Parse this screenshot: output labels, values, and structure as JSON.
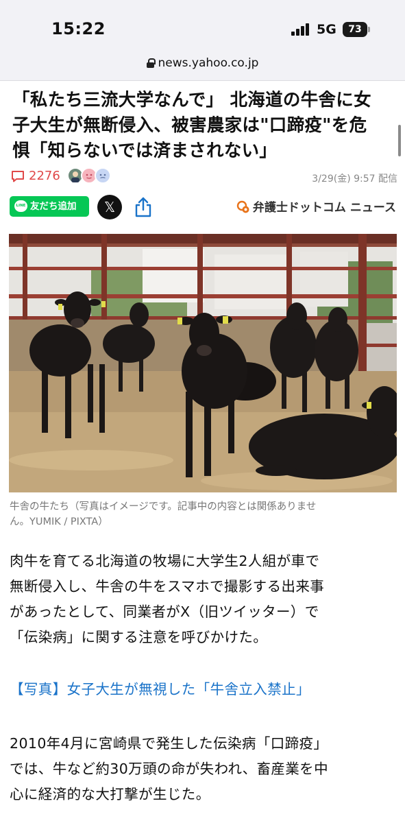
{
  "status_bar": {
    "time": "15:22",
    "network": "5G",
    "battery": "73"
  },
  "browser": {
    "url": "news.yahoo.co.jp"
  },
  "article": {
    "title_lines": [
      "「私たち三流大学なんで」 北海道の牛舎に女",
      "子大生が無断侵入、被害農家は\"口蹄疫\"を危",
      "惧「知らないでは済まされない」"
    ],
    "comment_count": "2276",
    "date": "3/29(金) 9:57 配信",
    "share": {
      "line_label": "友だち追加",
      "line_icon_text": "LINE",
      "x_label": "𝕏"
    },
    "source_brand": "弁護士ドットコム ニュース",
    "photo_caption_lines": [
      "牛舎の牛たち（写真はイメージです。記事中の内容とは関係ありませ",
      "ん。YUMIK / PIXTA）"
    ],
    "paragraph1_lines": [
      "肉牛を育てる北海道の牧場に大学生2人組が車で",
      "無断侵入し、牛舎の牛をスマホで撮影する出来事",
      "があったとして、同業者がX（旧ツイッター）で",
      "「伝染病」に関する注意を呼びかけた。"
    ],
    "photo_link": "【写真】女子大生が無視した「牛舎立入禁止」",
    "paragraph2_lines": [
      "2010年4月に宮崎県で発生した伝染病「口蹄疫」",
      "では、牛など約30万頭の命が失われ、畜産業を中",
      "心に経済的な大打撃が生じた。"
    ]
  },
  "colors": {
    "comment_red": "#e04848",
    "line_green": "#06c755",
    "link_blue": "#1a73c9",
    "brand_orange": "#e8731a"
  }
}
